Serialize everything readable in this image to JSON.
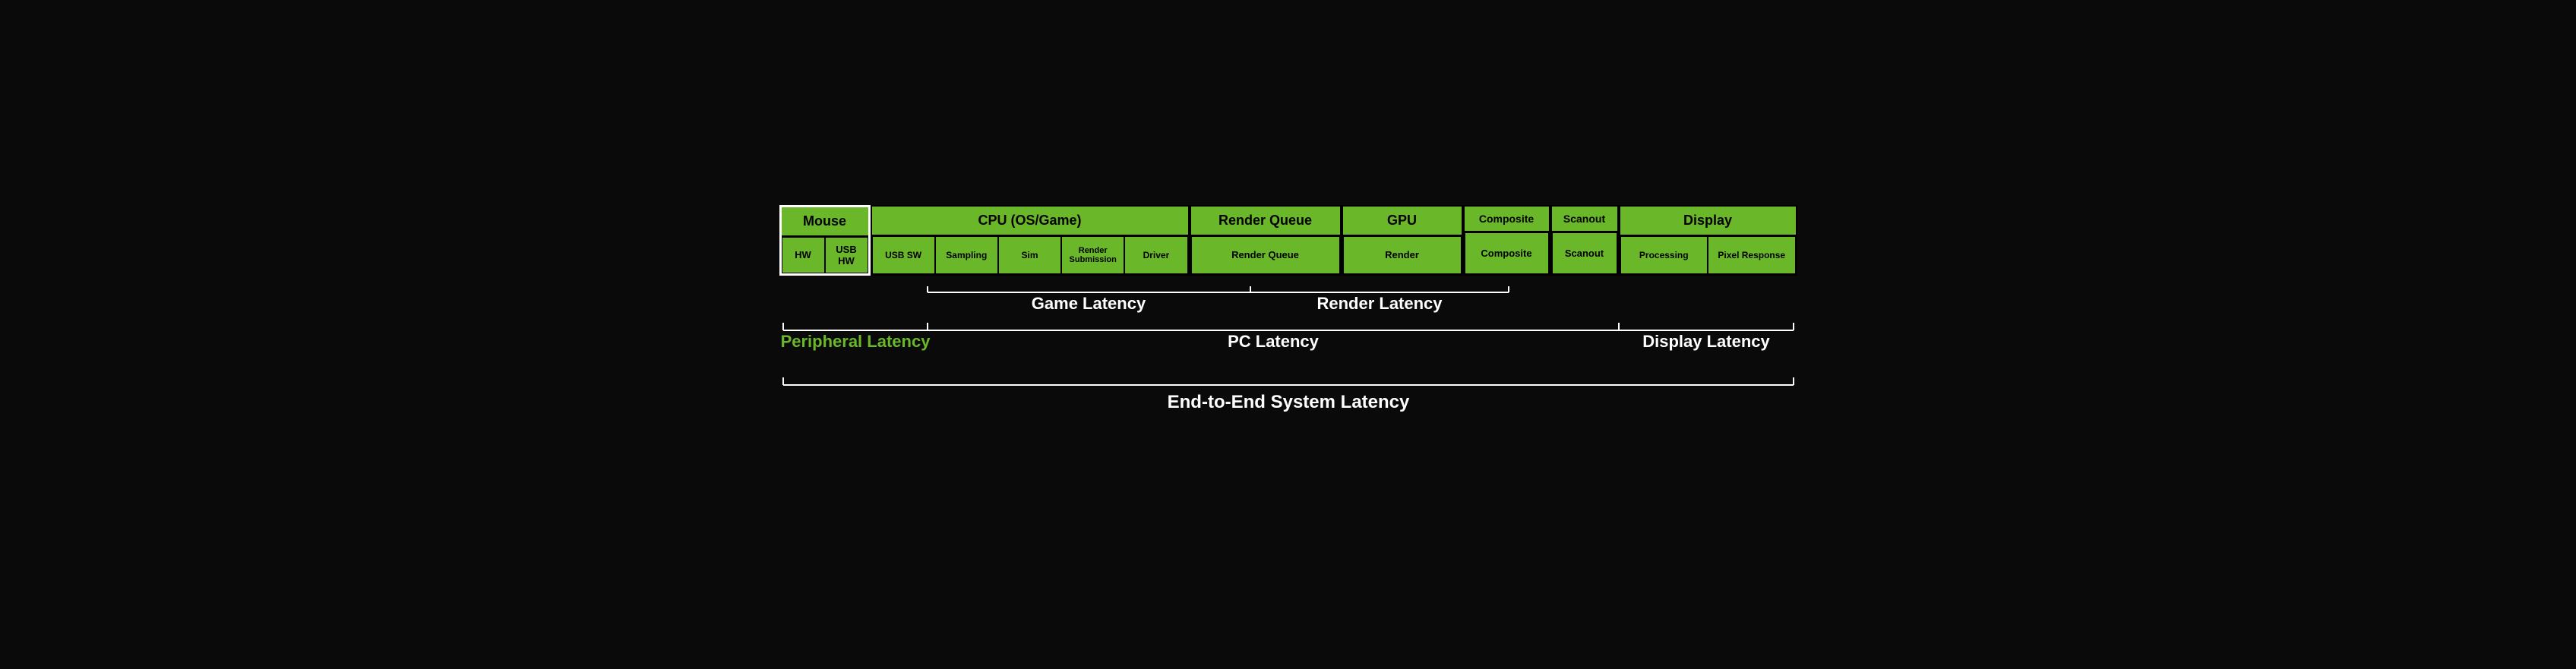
{
  "diagram": {
    "mouse": {
      "title": "Mouse",
      "hw": "HW",
      "usb_hw": "USB HW"
    },
    "cpu": {
      "title": "CPU (OS/Game)",
      "cells": [
        "USB SW",
        "Sampling",
        "Sim",
        "Render Submission",
        "Driver"
      ]
    },
    "render_queue": {
      "title": "Render Queue",
      "cell": "Render Queue"
    },
    "gpu": {
      "title": "GPU",
      "cell": "Render"
    },
    "composite": {
      "title": "Composite",
      "cell": "Composite"
    },
    "scanout": {
      "title": "Scanout",
      "cell": "Scanout"
    },
    "display": {
      "title": "Display",
      "cells": [
        "Processing",
        "Pixel Response"
      ]
    },
    "brackets": {
      "game_latency": "Game Latency",
      "render_latency": "Render Latency",
      "peripheral_latency": "Peripheral Latency",
      "pc_latency": "PC Latency",
      "display_latency": "Display Latency",
      "end_to_end": "End-to-End System Latency"
    }
  }
}
